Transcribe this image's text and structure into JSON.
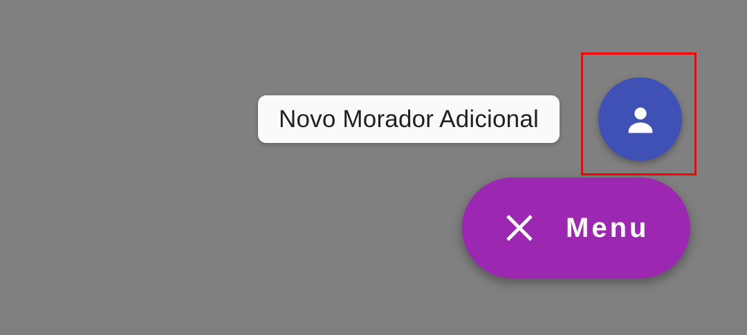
{
  "colors": {
    "scrim": "#808080",
    "mini_fab": "#3f51b5",
    "extended_fab": "#9c27b0",
    "highlight": "#ff0000",
    "icon": "#ffffff"
  },
  "speed_dial": {
    "action_label": "Novo Morador Adicional",
    "action_icon": "person-icon"
  },
  "main_fab": {
    "label": "Menu",
    "icon": "close-icon"
  }
}
